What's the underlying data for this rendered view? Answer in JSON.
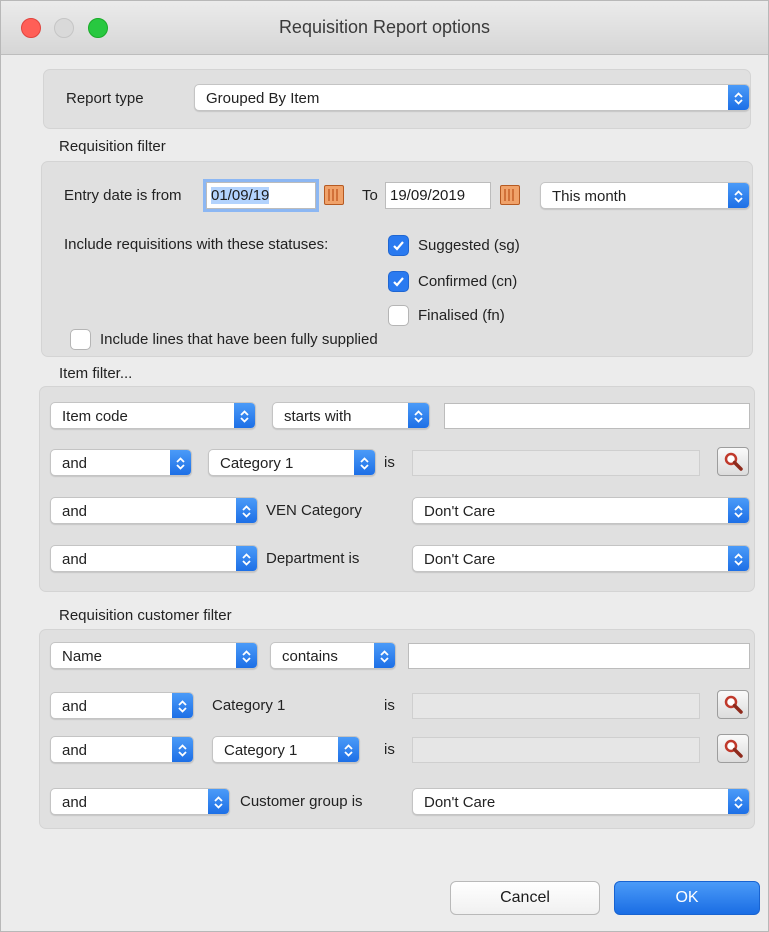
{
  "window": {
    "title": "Requisition Report options"
  },
  "report_type": {
    "label": "Report type",
    "value": "Grouped By Item"
  },
  "requisition_filter": {
    "heading": "Requisition filter",
    "entry_date_label": "Entry date is from",
    "date_from": "01/09/19",
    "to_label": "To",
    "date_to": "19/09/2019",
    "period": "This month",
    "statuses_label": "Include requisitions with these statuses:",
    "statuses": [
      {
        "label": "Suggested (sg)",
        "checked": true
      },
      {
        "label": "Confirmed (cn)",
        "checked": true
      },
      {
        "label": "Finalised (fn)",
        "checked": false
      }
    ],
    "fully_supplied_label": "Include lines that have been fully supplied",
    "fully_supplied_checked": false
  },
  "item_filter": {
    "heading": "Item filter...",
    "row1": {
      "field": "Item code",
      "operator": "starts with",
      "value": ""
    },
    "row2": {
      "conj": "and",
      "field": "Category 1",
      "is_label": "is",
      "value": ""
    },
    "row3": {
      "conj": "and",
      "label": "VEN Category",
      "value": "Don't Care"
    },
    "row4": {
      "conj": "and",
      "label": "Department is",
      "value": "Don't Care"
    }
  },
  "customer_filter": {
    "heading": "Requisition customer filter",
    "row1": {
      "field": "Name",
      "operator": "contains",
      "value": ""
    },
    "row2": {
      "conj": "and",
      "label": "Category 1",
      "is_label": "is",
      "value": ""
    },
    "row3": {
      "conj": "and",
      "field": "Category 1",
      "is_label": "is",
      "value": ""
    },
    "row4": {
      "conj": "and",
      "label": "Customer group is",
      "value": "Don't Care"
    }
  },
  "buttons": {
    "cancel": "Cancel",
    "ok": "OK"
  },
  "colors": {
    "accent": "#2a7af0",
    "close": "#ff5f57",
    "maximize": "#28c840"
  }
}
